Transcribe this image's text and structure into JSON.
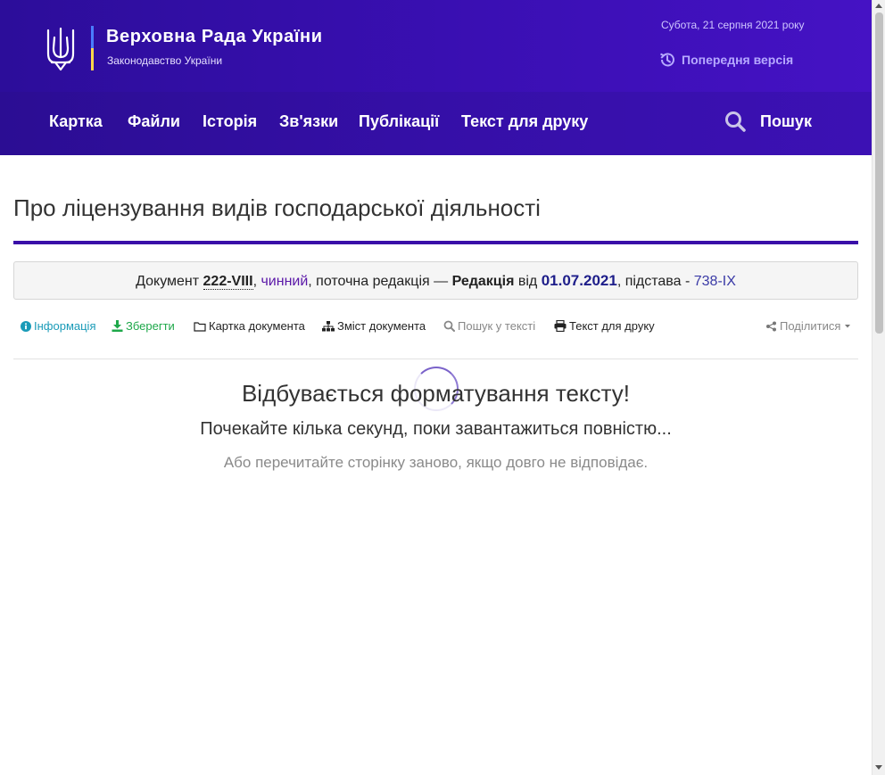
{
  "header": {
    "title": "Верховна Рада України",
    "subtitle": "Законодавство України",
    "date": "Субота, 21 серпня 2021 року",
    "prev_version": "Попередня версія"
  },
  "nav": {
    "items": [
      "Картка",
      "Файли",
      "Історія",
      "Зв'язки",
      "Публікації",
      "Текст для друку"
    ],
    "search": "Пошук"
  },
  "document": {
    "title": "Про ліцензування видів господарської діяльності",
    "prefix": "Документ",
    "number": "222-VIII",
    "status": "чинний",
    "edition_text": ", поточна редакція —",
    "edition_label": "Редакція",
    "from": "від",
    "date": "01.07.2021",
    "basis_text": ", підстава -",
    "basis": "738-IX"
  },
  "toolbar": {
    "info": "Інформація",
    "save": "Зберегти",
    "card": "Картка документа",
    "contents": "Зміст документа",
    "search_text": "Пошук у тексті",
    "print": "Текст для друку",
    "share": "Поділитися"
  },
  "loading": {
    "h1": "Відбувається форматування тексту!",
    "h2": "Почекайте кілька секунд, поки завантажиться повністю...",
    "h3": "Або перечитайте сторінку заново, якщо довго не відповідає."
  },
  "colors": {
    "header_bg": "#3a0fb3",
    "accent": "#3a0fa8",
    "status": "#5a17a8",
    "info": "#1a9bb8",
    "save": "#1ea84a"
  }
}
